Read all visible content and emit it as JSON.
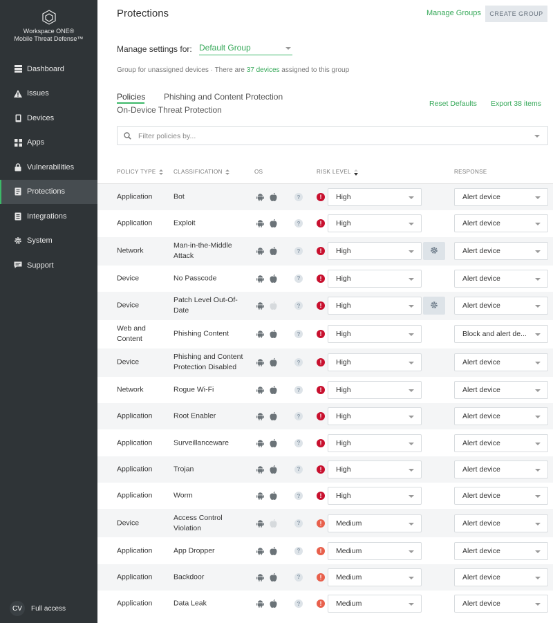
{
  "brand": {
    "line1": "Workspace ONE®",
    "line2": "Mobile Threat Defense™"
  },
  "nav": [
    {
      "label": "Dashboard",
      "icon": "dashboard-icon",
      "active": false
    },
    {
      "label": "Issues",
      "icon": "warning-icon",
      "active": false
    },
    {
      "label": "Devices",
      "icon": "device-icon",
      "active": false
    },
    {
      "label": "Apps",
      "icon": "apps-grid-icon",
      "active": false
    },
    {
      "label": "Vulnerabilities",
      "icon": "lock-icon",
      "active": false
    },
    {
      "label": "Protections",
      "icon": "shield-icon",
      "active": true
    },
    {
      "label": "Integrations",
      "icon": "integrations-icon",
      "active": false
    },
    {
      "label": "System",
      "icon": "gear-icon",
      "active": false
    },
    {
      "label": "Support",
      "icon": "chat-icon",
      "active": false
    }
  ],
  "user": {
    "initials": "CV",
    "access": "Full access"
  },
  "header": {
    "title": "Protections",
    "manage_groups": "Manage Groups",
    "create_group": "CREATE GROUP"
  },
  "settings": {
    "label": "Manage settings for:",
    "group": "Default Group",
    "info_prefix": "Group for unassigned devices · There are ",
    "info_link": "37 devices",
    "info_suffix": " assigned to this group"
  },
  "tabs": [
    {
      "label": "Policies",
      "active": true
    },
    {
      "label": "Phishing and Content Protection",
      "active": false
    },
    {
      "label": "On-Device Threat Protection",
      "active": false
    }
  ],
  "actions": {
    "reset": "Reset Defaults",
    "export": "Export 38 items"
  },
  "filter": {
    "placeholder": "Filter policies by..."
  },
  "columns": {
    "policy_type": "POLICY TYPE",
    "classification": "CLASSIFICATION",
    "os": "OS",
    "risk_level": "RISK LEVEL",
    "response": "RESPONSE"
  },
  "colors": {
    "accent": "#3cb868",
    "sidebar": "#2f3437",
    "high": "#c8102e",
    "medium": "#e8604c"
  },
  "rows": [
    {
      "type": "Application",
      "classification": "Bot",
      "android": true,
      "apple": true,
      "risk": "High",
      "response": "Alert device",
      "gear": false
    },
    {
      "type": "Application",
      "classification": "Exploit",
      "android": true,
      "apple": true,
      "risk": "High",
      "response": "Alert device",
      "gear": false
    },
    {
      "type": "Network",
      "classification": "Man-in-the-Middle Attack",
      "android": true,
      "apple": true,
      "risk": "High",
      "response": "Alert device",
      "gear": true
    },
    {
      "type": "Device",
      "classification": "No Passcode",
      "android": true,
      "apple": true,
      "risk": "High",
      "response": "Alert device",
      "gear": false
    },
    {
      "type": "Device",
      "classification": "Patch Level Out-Of-Date",
      "android": true,
      "apple": false,
      "risk": "High",
      "response": "Alert device",
      "gear": true
    },
    {
      "type": "Web and Content",
      "classification": "Phishing Content",
      "android": true,
      "apple": true,
      "risk": "High",
      "response": "Block and alert de...",
      "gear": false
    },
    {
      "type": "Device",
      "classification": "Phishing and Content Protection Disabled",
      "android": true,
      "apple": true,
      "risk": "High",
      "response": "Alert device",
      "gear": false
    },
    {
      "type": "Network",
      "classification": "Rogue Wi-Fi",
      "android": true,
      "apple": true,
      "risk": "High",
      "response": "Alert device",
      "gear": false
    },
    {
      "type": "Application",
      "classification": "Root Enabler",
      "android": true,
      "apple": true,
      "risk": "High",
      "response": "Alert device",
      "gear": false
    },
    {
      "type": "Application",
      "classification": "Surveillanceware",
      "android": true,
      "apple": true,
      "risk": "High",
      "response": "Alert device",
      "gear": false
    },
    {
      "type": "Application",
      "classification": "Trojan",
      "android": true,
      "apple": true,
      "risk": "High",
      "response": "Alert device",
      "gear": false
    },
    {
      "type": "Application",
      "classification": "Worm",
      "android": true,
      "apple": true,
      "risk": "High",
      "response": "Alert device",
      "gear": false
    },
    {
      "type": "Device",
      "classification": "Access Control Violation",
      "android": true,
      "apple": false,
      "risk": "Medium",
      "response": "Alert device",
      "gear": false
    },
    {
      "type": "Application",
      "classification": "App Dropper",
      "android": true,
      "apple": true,
      "risk": "Medium",
      "response": "Alert device",
      "gear": false
    },
    {
      "type": "Application",
      "classification": "Backdoor",
      "android": true,
      "apple": true,
      "risk": "Medium",
      "response": "Alert device",
      "gear": false
    },
    {
      "type": "Application",
      "classification": "Data Leak",
      "android": true,
      "apple": true,
      "risk": "Medium",
      "response": "Alert device",
      "gear": false
    }
  ]
}
